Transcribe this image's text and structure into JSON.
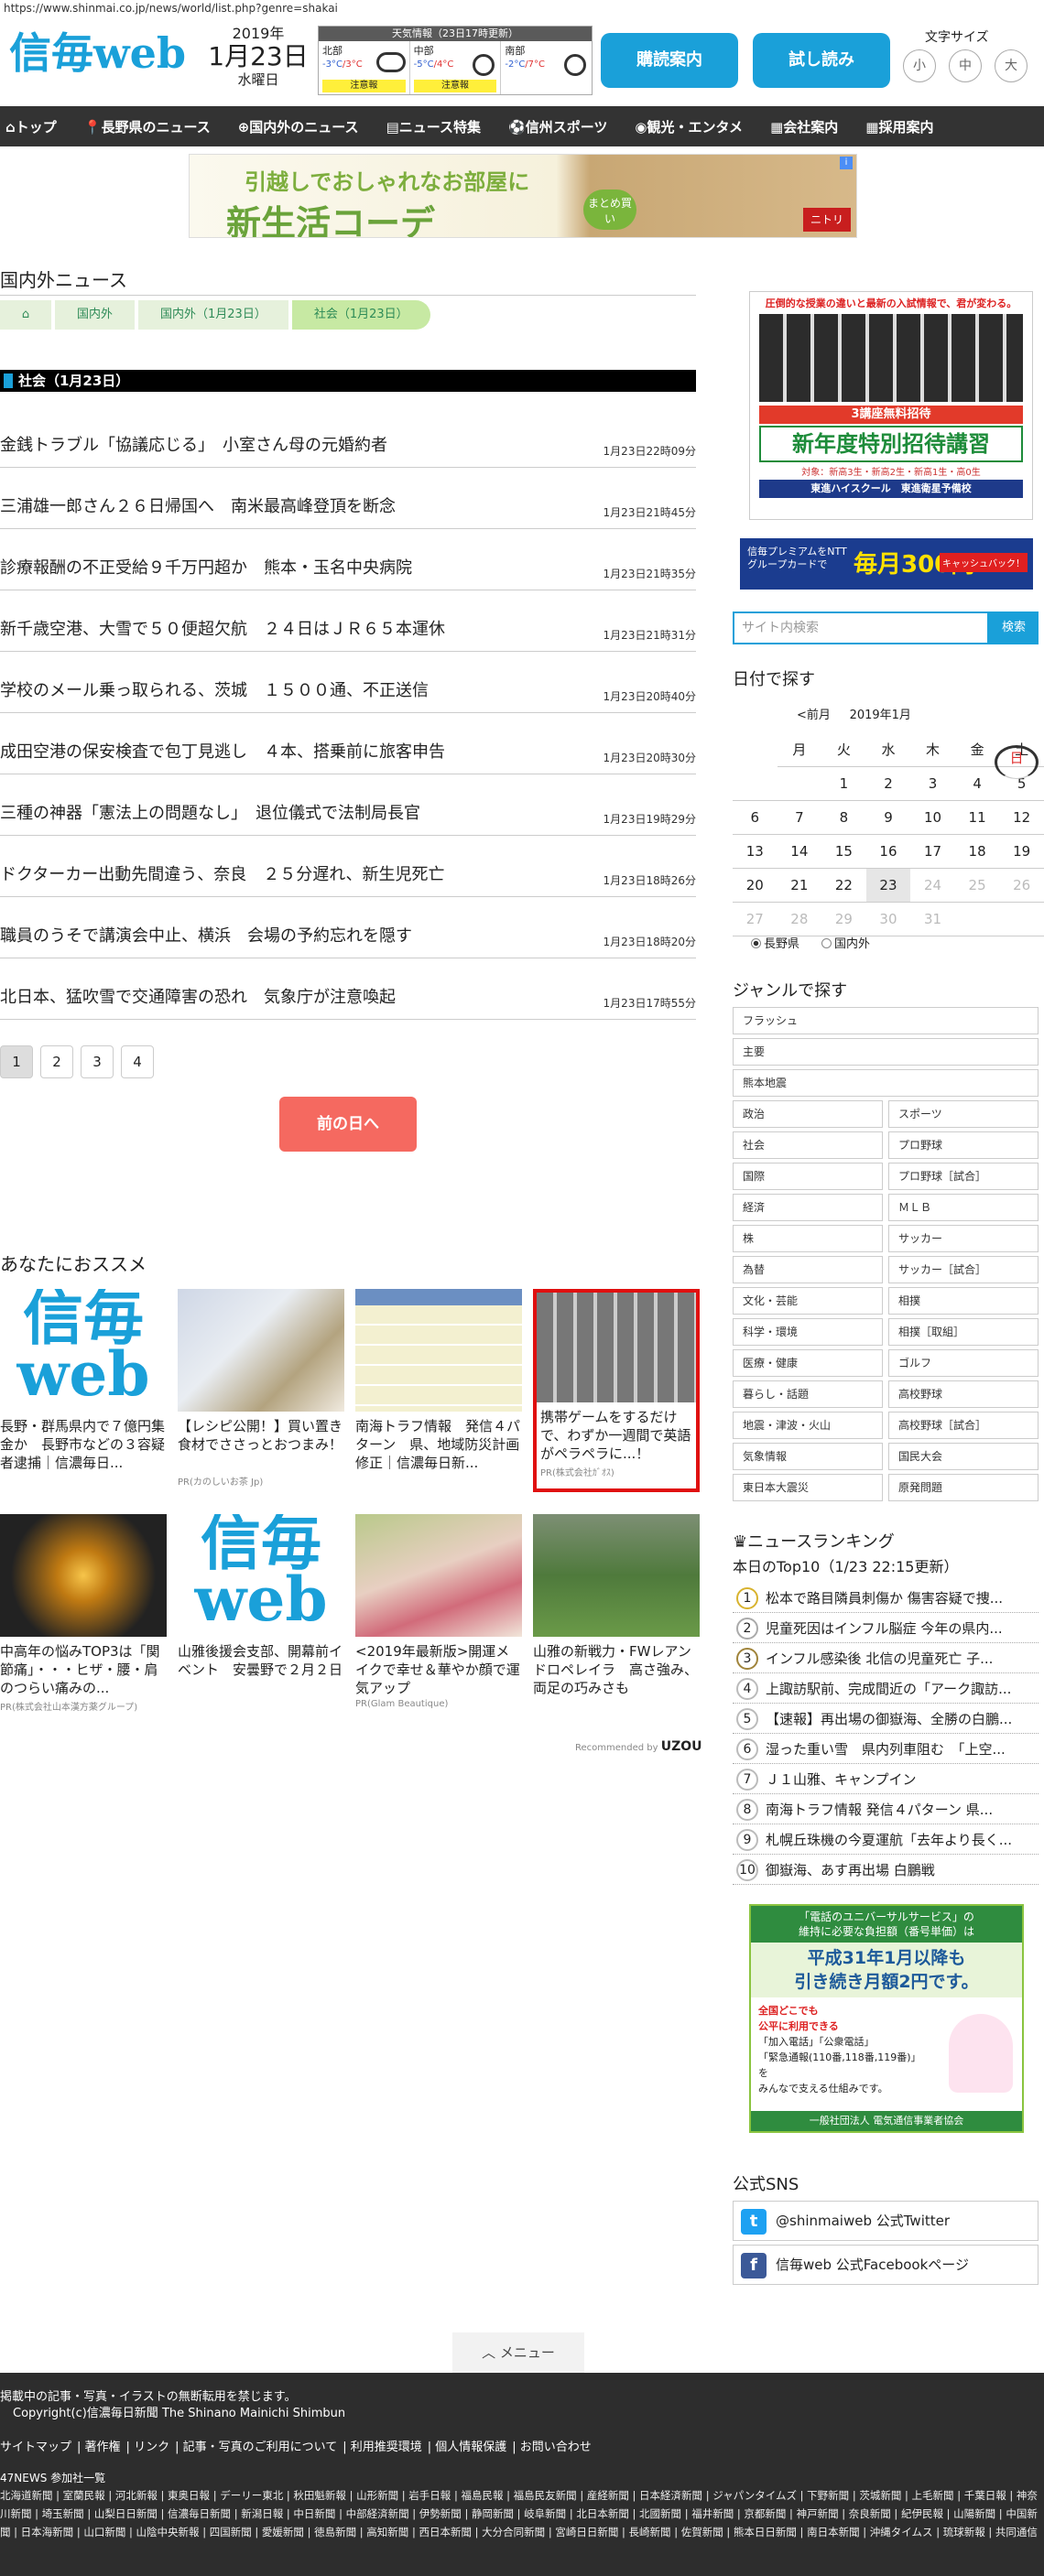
{
  "url": "https://www.shinmai.co.jp/news/world/list.php?genre=shakai",
  "logo": "信毎web",
  "date": {
    "year": "2019年",
    "md": "1月23日",
    "weekday": "水曜日"
  },
  "weather": {
    "title": "天気情報（23日17時更新）",
    "regions": [
      {
        "name": "北部",
        "low": "-3°C",
        "high": "3°C",
        "warn": "注意報",
        "icon": "cloud-icon"
      },
      {
        "name": "中部",
        "low": "-5°C",
        "high": "4°C",
        "warn": "注意報",
        "icon": "sun-icon"
      },
      {
        "name": "南部",
        "low": "-2°C",
        "high": "7°C",
        "warn": "",
        "icon": "sun-icon"
      }
    ]
  },
  "header_buttons": {
    "delivery": "購読案内",
    "trial": "試し読み"
  },
  "font_size": {
    "label": "文字サイズ",
    "small": "小",
    "medium": "中",
    "large": "大"
  },
  "nav": [
    "トップ",
    "長野県のニュース",
    "国内外のニュース",
    "ニュース特集",
    "信州スポーツ",
    "観光・エンタメ",
    "会社案内",
    "採用案内"
  ],
  "banner": {
    "line1": "引越しでおしゃれなお部屋に",
    "line2": "新生活コーデ",
    "badge": "まとめ買い",
    "brand": "ニトリ",
    "adchoice": "i"
  },
  "section_title": "国内外ニュース",
  "breadcrumb": [
    "国内外",
    "国内外（1月23日）",
    "社会（1月23日）"
  ],
  "category_header": "社会（1月23日）",
  "news": [
    {
      "title": "金銭トラブル「協議応じる」　小室さん母の元婚約者",
      "time": "1月23日22時09分"
    },
    {
      "title": "三浦雄一郎さん２６日帰国へ　南米最高峰登頂を断念",
      "time": "1月23日21時45分"
    },
    {
      "title": "診療報酬の不正受給９千万円超か　熊本・玉名中央病院",
      "time": "1月23日21時35分"
    },
    {
      "title": "新千歳空港、大雪で５０便超欠航　２４日はＪＲ６５本運休",
      "time": "1月23日21時31分"
    },
    {
      "title": "学校のメール乗っ取られる、茨城　１５００通、不正送信",
      "time": "1月23日20時40分"
    },
    {
      "title": "成田空港の保安検査で包丁見逃し　４本、搭乗前に旅客申告",
      "time": "1月23日20時30分"
    },
    {
      "title": "三種の神器「憲法上の問題なし」　退位儀式で法制局長官",
      "time": "1月23日19時29分"
    },
    {
      "title": "ドクターカー出動先間違う、奈良　２５分遅れ、新生児死亡",
      "time": "1月23日18時26分"
    },
    {
      "title": "職員のうそで講演会中止、横浜　会場の予約忘れを隠す",
      "time": "1月23日18時20分"
    },
    {
      "title": "北日本、猛吹雪で交通障害の恐れ　気象庁が注意喚起",
      "time": "1月23日17時55分"
    }
  ],
  "pager": [
    "1",
    "2",
    "3",
    "4"
  ],
  "prev_day": "前の日へ",
  "recommend_title": "あなたにおススメ",
  "recommend": [
    {
      "caption": "長野・群馬県内で７億円集金か　長野市などの３容疑者逮捕｜信濃毎日...",
      "pr": "",
      "img": "shinmai"
    },
    {
      "caption": "【レシピ公開！】買い置き食材でささっとおつまみ！",
      "pr": "PR(カのしいお茶 Jp)",
      "img": "food"
    },
    {
      "caption": "南海トラフ情報　発信４パターン　県、地域防災計画修正｜信濃毎日新...",
      "pr": "",
      "img": "table"
    },
    {
      "caption": "携帯ゲームをするだけで、わずか一週間で英語がペラペラに...！",
      "pr": "PR(株式会社ｶﾞｵｽ)",
      "img": "keys"
    },
    {
      "caption": "中高年の悩みTOP3は「関節痛」・・・ヒザ・腰・肩のつらい痛みの...",
      "pr": "PR(株式会社山本漢方薬グループ)",
      "img": "lightning"
    },
    {
      "caption": "山雅後援会支部、開幕前イベント　安曇野で２月２日",
      "pr": "",
      "img": "shinmai"
    },
    {
      "caption": "<2019年最新版>開運メイクで幸せ＆華やか顔で運気アップ",
      "pr": "PR(Glam Beautique)",
      "img": "kimono"
    },
    {
      "caption": "山雅の新戦力・FWレアンドロペレイラ　高さ強み、両足の巧みさも",
      "pr": "",
      "img": "soccer"
    }
  ],
  "recommended_by": "Recommended by",
  "uzou": "UZOU",
  "side_ad1": {
    "top": "圧倒的な授業の違いと最新の入試情報で、君が変わる。",
    "ribbon": "3講座無料招待",
    "main": "新年度特別招待講習",
    "sub": "対象：新高3生・新高2生・新高1生・高0生",
    "brand": "東進ハイスクール　東進衛星予備校"
  },
  "side_ad2": {
    "text": "信毎プレミアムをNTTグループカードで",
    "amount": "毎月300円",
    "tag": "キャッシュバック！"
  },
  "search": {
    "placeholder": "サイト内検索",
    "button": "検索"
  },
  "date_search": {
    "title": "日付で探す",
    "prev": "<前月",
    "month": "2019年1月"
  },
  "calendar": {
    "head": [
      "日",
      "月",
      "火",
      "水",
      "木",
      "金",
      "土"
    ],
    "weeks": [
      [
        "",
        "",
        "1",
        "2",
        "3",
        "4",
        "5"
      ],
      [
        "6",
        "7",
        "8",
        "9",
        "10",
        "11",
        "12"
      ],
      [
        "13",
        "14",
        "15",
        "16",
        "17",
        "18",
        "19"
      ],
      [
        "20",
        "21",
        "22",
        "23",
        "24",
        "25",
        "26"
      ],
      [
        "27",
        "28",
        "29",
        "30",
        "31",
        "",
        ""
      ]
    ]
  },
  "radios": [
    "長野県",
    "国内外"
  ],
  "genre_title": "ジャンルで探す",
  "genres_full": [
    "フラッシュ",
    "主要",
    "熊本地震"
  ],
  "genres_pairs": [
    [
      "政治",
      "スポーツ"
    ],
    [
      "社会",
      "プロ野球"
    ],
    [
      "国際",
      "プロ野球［試合］"
    ],
    [
      "経済",
      "ＭＬＢ"
    ],
    [
      "株",
      "サッカー"
    ],
    [
      "為替",
      "サッカー［試合］"
    ],
    [
      "文化・芸能",
      "相撲"
    ],
    [
      "科学・環境",
      "相撲［取組］"
    ],
    [
      "医療・健康",
      "ゴルフ"
    ],
    [
      "暮らし・話題",
      "高校野球"
    ],
    [
      "地震・津波・火山",
      "高校野球［試合］"
    ],
    [
      "気象情報",
      "国民大会"
    ],
    [
      "東日本大震災",
      "原発問題"
    ]
  ],
  "ranking": {
    "title": "ニュースランキング",
    "sub": "本日のTop10（1/23 22:15更新）",
    "items": [
      "松本で路目隣員刺傷か 傷害容疑で捜...",
      "児童死因はインフル脳症 今年の県内...",
      "インフル感染後 北信の児童死亡 子...",
      "上諏訪駅前、完成間近の「アーク諏訪...",
      "【速報】再出場の御嶽海、全勝の白鵬...",
      "湿った重い雪　県内列車阻む　「上空...",
      "Ｊ１山雅、キャンプイン",
      "南海トラフ情報 発信４パターン 県...",
      "札幌丘珠機の今夏運航「去年より長く...",
      "御嶽海、あす再出場 白鵬戦"
    ]
  },
  "side_ad3": {
    "l1": "「電話のユニバーサルサービス」の",
    "l2": "維持に必要な負担額（番号単価）は",
    "l3": "平成31年1月以降も",
    "l4": "引き続き月額2円です。",
    "l5": "全国どこでも",
    "l6": "公平に利用できる",
    "l7": "「加入電話」「公衆電話」",
    "l8": "「緊急通報(110番,118番,119番)」を",
    "l9": "みんなで支える仕組みです。",
    "l10": "一般社団法人 電気通信事業者協会"
  },
  "sns": {
    "title": "公式SNS",
    "twitter": "@shinmaiweb 公式Twitter",
    "facebook": "信毎web 公式Facebookページ"
  },
  "menu_tab": "メニュー",
  "footer": {
    "notice": "掲載中の記事・写真・イラストの無断転用を禁じます。",
    "copyright": "Copyright(c)信濃毎日新聞 The Shinano Mainichi Shimbun",
    "links": [
      "サイトマップ",
      "著作権",
      "リンク",
      "記事・写真のご利用について",
      "利用推奨環境",
      "個人情報保護",
      "お問い合わせ"
    ],
    "n47": "47NEWS 参加社一覧",
    "newspapers": "北海道新聞 | 室蘭民報 | 河北新報 | 東奥日報 | デーリー東北 | 秋田魁新報 | 山形新聞 | 岩手日報 | 福島民報 | 福島民友新聞 | 産経新聞 | 日本経済新聞 | ジャパンタイムズ | 下野新聞 | 茨城新聞 | 上毛新聞 | 千葉日報 | 神奈川新聞 | 埼玉新聞 | 山梨日日新聞 | 信濃毎日新聞 | 新潟日報 | 中日新聞 | 中部経済新聞 | 伊勢新聞 | 静岡新聞 | 岐阜新聞 | 北日本新聞 | 北國新聞 | 福井新聞 | 京都新聞 | 神戸新聞 | 奈良新聞 | 紀伊民報 | 山陽新聞 | 中国新聞 | 日本海新聞 | 山口新聞 | 山陰中央新報 | 四国新聞 | 愛媛新聞 | 徳島新聞 | 高知新聞 | 西日本新聞 | 大分合同新聞 | 宮崎日日新聞 | 長崎新聞 | 佐賀新聞 | 熊本日日新聞 | 南日本新聞 | 沖縄タイムス | 琉球新報 | 共同通信"
  }
}
